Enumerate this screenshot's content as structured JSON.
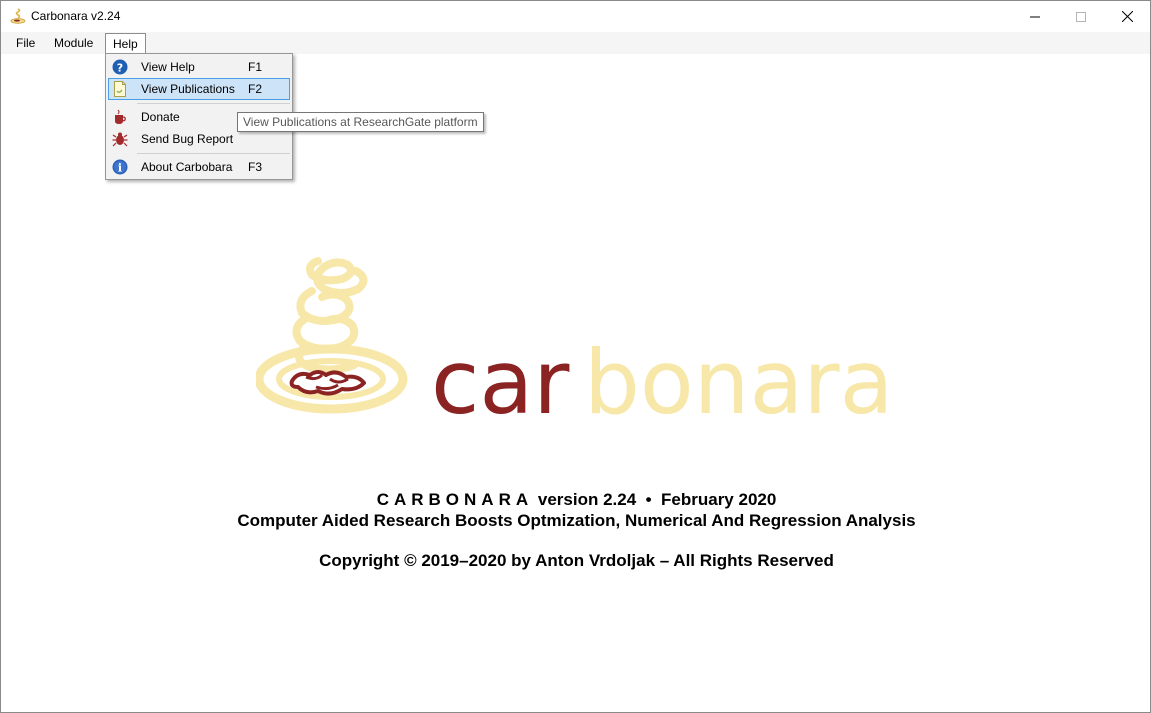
{
  "window": {
    "title": "Carbonara v2.24",
    "icon": "carbonara-plate-icon"
  },
  "menubar": {
    "file": "File",
    "module": "Module",
    "help": "Help"
  },
  "help_menu": {
    "items": [
      {
        "label": "View Help",
        "shortcut": "F1",
        "icon": "help-question-icon"
      },
      {
        "label": "View Publications",
        "shortcut": "F2",
        "icon": "document-icon",
        "highlighted": true
      },
      {
        "label": "Donate",
        "shortcut": "",
        "icon": "coffee-cup-icon"
      },
      {
        "label": "Send Bug Report",
        "shortcut": "",
        "icon": "bug-icon"
      },
      {
        "label": "About Carbobara",
        "shortcut": "F3",
        "icon": "info-icon"
      }
    ]
  },
  "tooltip": "View Publications at ResearchGate platform",
  "logo": {
    "word_part1": "car",
    "word_part2": "bonara",
    "color_dark": "#8b2323",
    "color_light": "#f7e7a8"
  },
  "about": {
    "name_spaced": "CARBONARA",
    "version_text": "version 2.24",
    "bullet": "•",
    "date": "February 2020",
    "subtitle": "Computer Aided Research Boosts Optmization, Numerical And Regression Analysis",
    "copyright": "Copyright © 2019–2020 by Anton Vrdoljak – All Rights Reserved"
  }
}
